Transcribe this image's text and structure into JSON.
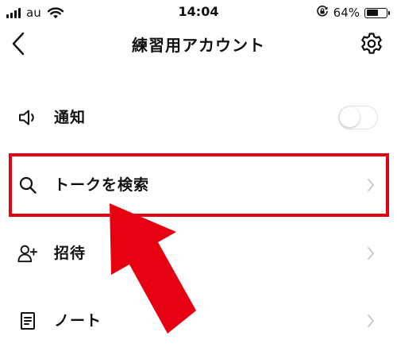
{
  "status_bar": {
    "carrier": "au",
    "time": "14:04",
    "battery_percent": "64%",
    "battery_level": 0.64,
    "signal_icon": "signal-bars-icon",
    "wifi_icon": "wifi-icon",
    "rotation_lock_icon": "rotation-lock-icon"
  },
  "nav": {
    "title": "練習用アカウント",
    "back_icon": "chevron-left-icon",
    "settings_icon": "gear-icon"
  },
  "menu": [
    {
      "id": "notification",
      "label": "通知",
      "icon": "speaker-icon",
      "accessory": "toggle",
      "toggle_on": false
    },
    {
      "id": "search-talk",
      "label": "トークを検索",
      "icon": "search-icon",
      "accessory": "chevron"
    },
    {
      "id": "invite",
      "label": "招待",
      "icon": "add-user-icon",
      "accessory": "chevron"
    },
    {
      "id": "note",
      "label": "ノート",
      "icon": "note-icon",
      "accessory": "chevron"
    }
  ],
  "annotation": {
    "highlight_color": "#e60012",
    "arrow_color": "#e60012",
    "highlighted_item": "search-talk"
  },
  "colors": {
    "text": "#111111",
    "chevron": "#c8c8c8",
    "background": "#ffffff"
  }
}
